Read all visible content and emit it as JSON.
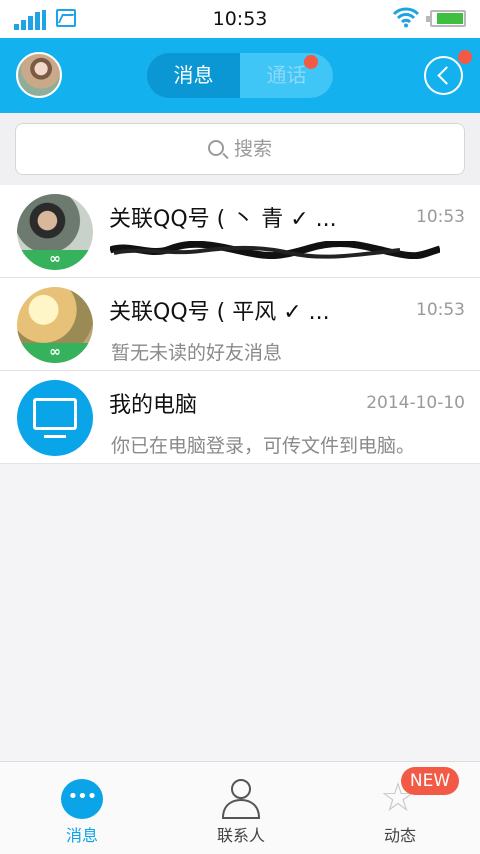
{
  "status_bar": {
    "time": "10:53"
  },
  "header": {
    "tabs": [
      {
        "label": "消息",
        "active": true
      },
      {
        "label": "通话",
        "active": false,
        "has_red_dot": true
      }
    ],
    "back_button_has_red_dot": true
  },
  "search": {
    "placeholder": "搜索"
  },
  "conversations": [
    {
      "title": "关联QQ号 ( 丶 青 ✓ ...",
      "time": "10:53",
      "subtitle": "",
      "subtitle_obscured": true,
      "avatar": "user-photo",
      "link_badge": "∞"
    },
    {
      "title": "关联QQ号 (  平风 ✓ ...",
      "time": "10:53",
      "subtitle": "暂无未读的好友消息",
      "avatar": "user-photo",
      "link_badge": "∞"
    },
    {
      "title": "我的电脑",
      "time": "2014-10-10",
      "subtitle": "你已在电脑登录，可传文件到电脑。",
      "avatar": "monitor-icon"
    }
  ],
  "tabbar": {
    "items": [
      {
        "label": "消息",
        "icon": "chat-bubble-icon",
        "active": true
      },
      {
        "label": "联系人",
        "icon": "contact-icon",
        "active": false
      },
      {
        "label": "动态",
        "icon": "star-icon",
        "active": false
      }
    ],
    "new_badge": "NEW"
  },
  "colors": {
    "accent": "#13b2ee",
    "badge_red": "#f25a45",
    "link_green": "#37b25c"
  }
}
